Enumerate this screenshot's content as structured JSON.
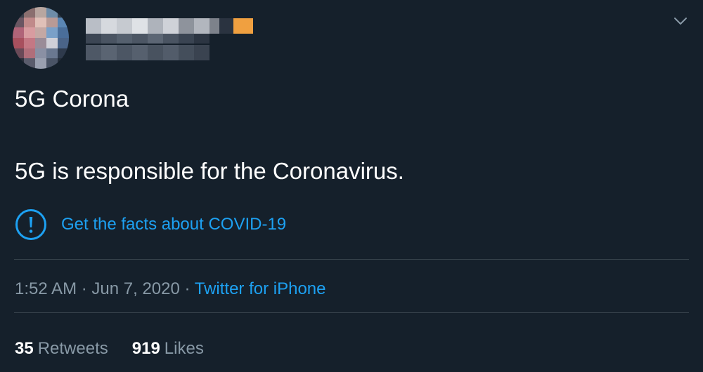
{
  "tweet": {
    "text_line1": "5G Corona",
    "text_line2": "5G is responsible for the Coronavirus.",
    "facts_link": "Get the facts about COVID-19",
    "time": "1:52 AM",
    "date": "Jun 7, 2020",
    "separator": "·",
    "source": "Twitter for iPhone",
    "retweets_count": "35",
    "retweets_label": "Retweets",
    "likes_count": "919",
    "likes_label": "Likes"
  },
  "icons": {
    "menu": "chevron-down-icon",
    "facts": "exclamation-circle-icon"
  },
  "colors": {
    "background": "#15202b",
    "accent": "#1da1f2",
    "secondary_text": "#8899a6",
    "divider": "#38444d"
  }
}
